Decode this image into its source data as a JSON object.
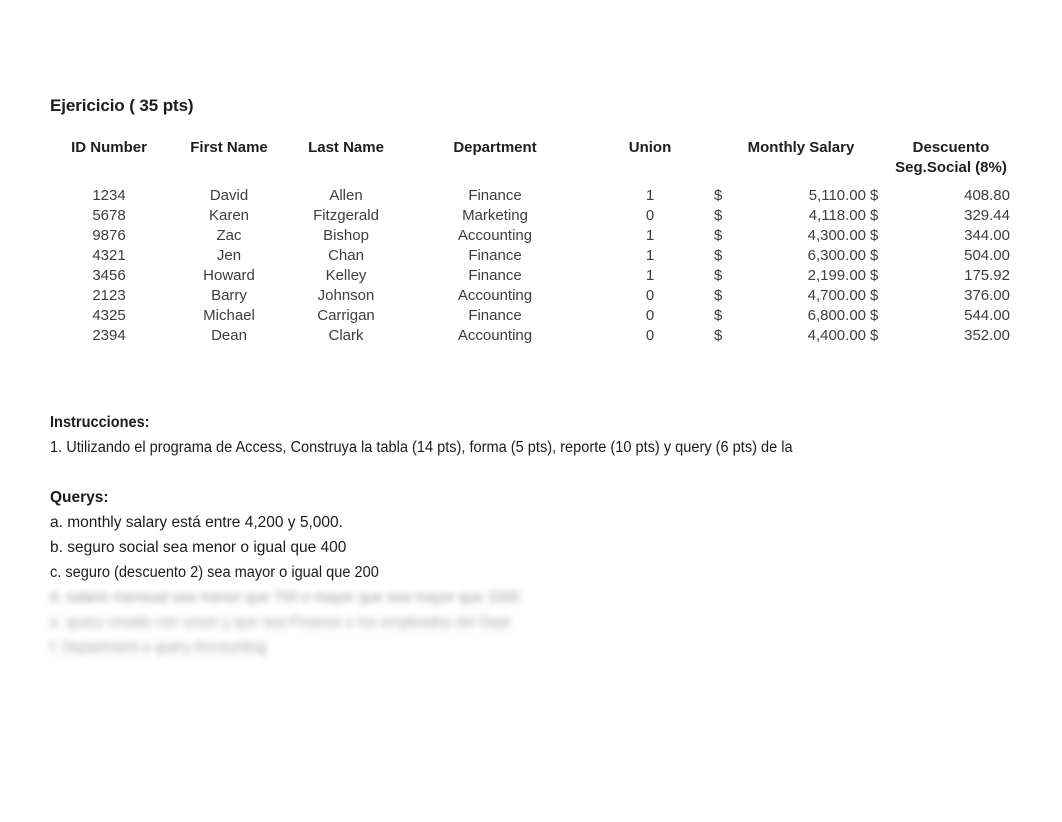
{
  "document": {
    "title": "Ejericicio ( 35 pts)"
  },
  "table": {
    "columns": [
      {
        "key": "id",
        "label": "ID Number"
      },
      {
        "key": "first_name",
        "label": "First Name"
      },
      {
        "key": "last_name",
        "label": "Last Name"
      },
      {
        "key": "department",
        "label": "Department"
      },
      {
        "key": "union",
        "label": "Union"
      },
      {
        "key": "salary",
        "label": "Monthly Salary"
      },
      {
        "key": "descuento",
        "label": "Descuento",
        "label_line2": "Seg.Social (8%)"
      }
    ],
    "currency_symbol": "$",
    "rows": [
      {
        "id": "1234",
        "first_name": "David",
        "last_name": "Allen",
        "department": "Finance",
        "union": "1",
        "salary": "5,110.00",
        "descuento": "408.80"
      },
      {
        "id": "5678",
        "first_name": "Karen",
        "last_name": "Fitzgerald",
        "department": "Marketing",
        "union": "0",
        "salary": "4,118.00",
        "descuento": "329.44"
      },
      {
        "id": "9876",
        "first_name": "Zac",
        "last_name": "Bishop",
        "department": "Accounting",
        "union": "1",
        "salary": "4,300.00",
        "descuento": "344.00"
      },
      {
        "id": "4321",
        "first_name": "Jen",
        "last_name": "Chan",
        "department": "Finance",
        "union": "1",
        "salary": "6,300.00",
        "descuento": "504.00"
      },
      {
        "id": "3456",
        "first_name": "Howard",
        "last_name": "Kelley",
        "department": "Finance",
        "union": "1",
        "salary": "2,199.00",
        "descuento": "175.92"
      },
      {
        "id": "2123",
        "first_name": "Barry",
        "last_name": "Johnson",
        "department": "Accounting",
        "union": "0",
        "salary": "4,700.00",
        "descuento": "376.00"
      },
      {
        "id": "4325",
        "first_name": "Michael",
        "last_name": "Carrigan",
        "department": "Finance",
        "union": "0",
        "salary": "6,800.00",
        "descuento": "544.00"
      },
      {
        "id": "2394",
        "first_name": "Dean",
        "last_name": "Clark",
        "department": "Accounting",
        "union": "0",
        "salary": "4,400.00",
        "descuento": "352.00"
      }
    ]
  },
  "instructions": {
    "heading": "Instrucciones:",
    "items": [
      "1. Utilizando el programa de Access, Construya la tabla (14 pts), forma (5 pts), reporte (10 pts) y query (6 pts) de la"
    ]
  },
  "querys": {
    "heading": "Querys:",
    "items": [
      "a. monthly salary está entre 4,200 y 5,000.",
      "b. seguro social sea menor o igual que 400",
      "c. seguro (descuento 2) sea mayor o igual que 200"
    ],
    "redacted_items": [
      "d. salario mensual sea menor que 700 o mayor que sea mayor que 1000",
      "e. query creado con union y que sea Finance o los empleados del Dept",
      "f. Department o query Accounting"
    ]
  }
}
